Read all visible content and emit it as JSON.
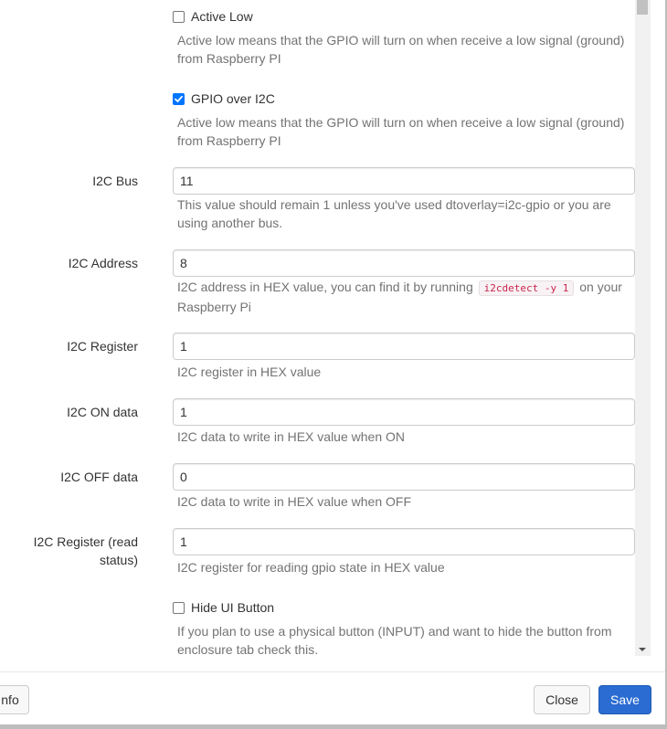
{
  "form": {
    "active_low": {
      "label": "Active Low",
      "checked": false,
      "help": "Active low means that the GPIO will turn on when receive a low signal (ground) from Raspberry PI"
    },
    "gpio_over_i2c": {
      "label": "GPIO over I2C",
      "checked": true,
      "help": "Active low means that the GPIO will turn on when receive a low signal (ground) from Raspberry PI"
    },
    "i2c_bus": {
      "label": "I2C Bus",
      "value": "11",
      "help": "This value should remain 1 unless you've used dtoverlay=i2c-gpio or you are using another bus."
    },
    "i2c_address": {
      "label": "I2C Address",
      "value": "8",
      "help_before": "I2C address in HEX value, you can find it by running",
      "help_code": "i2cdetect -y 1",
      "help_after": "on your Raspberry Pi"
    },
    "i2c_register": {
      "label": "I2C Register",
      "value": "1",
      "help": "I2C register in HEX value"
    },
    "i2c_on_data": {
      "label": "I2C ON data",
      "value": "1",
      "help": "I2C data to write in HEX value when ON"
    },
    "i2c_off_data": {
      "label": "I2C OFF data",
      "value": "0",
      "help": "I2C data to write in HEX value when OFF"
    },
    "i2c_register_read": {
      "label_line1": "I2C Register (read",
      "label_line2": "status)",
      "value": "1",
      "help": "I2C register for reading gpio state in HEX value"
    },
    "hide_ui_button": {
      "label": "Hide UI Button",
      "checked": false,
      "help": "If you plan to use a physical button (INPUT) and want to hide the button from enclosure tab check this."
    }
  },
  "footer": {
    "info_label": "nfo",
    "close_label": "Close",
    "save_label": "Save"
  },
  "colors": {
    "primary": "#2a6cd1",
    "checkbox_checked": "#0075ff",
    "help_text": "#737373",
    "code_text": "#c7254e"
  }
}
